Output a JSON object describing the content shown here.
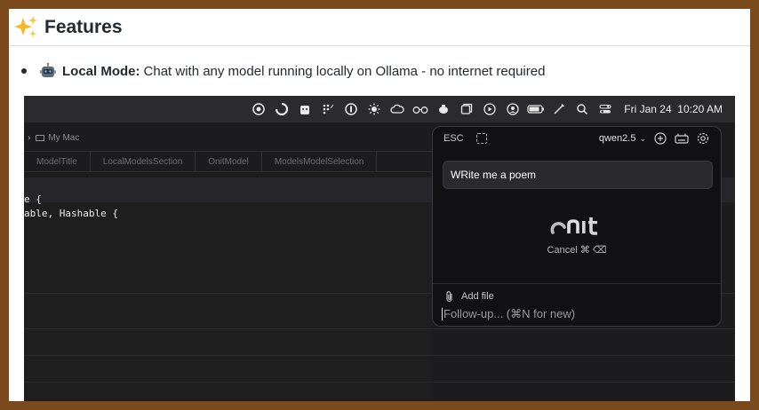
{
  "heading": {
    "title": "Features"
  },
  "bullet": {
    "strong": "Local Mode:",
    "text": "Chat with any model running locally on Ollama - no internet required"
  },
  "menubar": {
    "date": "Fri Jan 24",
    "time": "10:20 AM",
    "icons": [
      "record-icon",
      "spinner-icon",
      "robot-icon",
      "grid-icon",
      "onepassword-icon",
      "sun-icon",
      "cloud-icon",
      "glasses-icon",
      "teapot-icon",
      "window-icon",
      "play-icon",
      "user-icon",
      "battery-icon",
      "pen-icon",
      "search-icon",
      "control-center-icon"
    ]
  },
  "xcode": {
    "scheme": "My Mac",
    "tabs": [
      "ModelTitle",
      "LocalModelsSection",
      "OnitModel",
      "ModelsModelSelection"
    ],
    "code": [
      "e {",
      "able, Hashable {"
    ]
  },
  "panel": {
    "esc": "ESC",
    "model": "qwen2.5",
    "prompt": "WRite me a poem",
    "logo_text": "onit",
    "cancel": "Cancel ⌘ ⌫",
    "add_file": "Add file",
    "followup_placeholder": "Follow-up... (⌘N for new)"
  },
  "colors": {
    "frame_border": "#7a4a1c",
    "panel_bg": "#111113",
    "prompt_bg": "#2a2a2d"
  }
}
